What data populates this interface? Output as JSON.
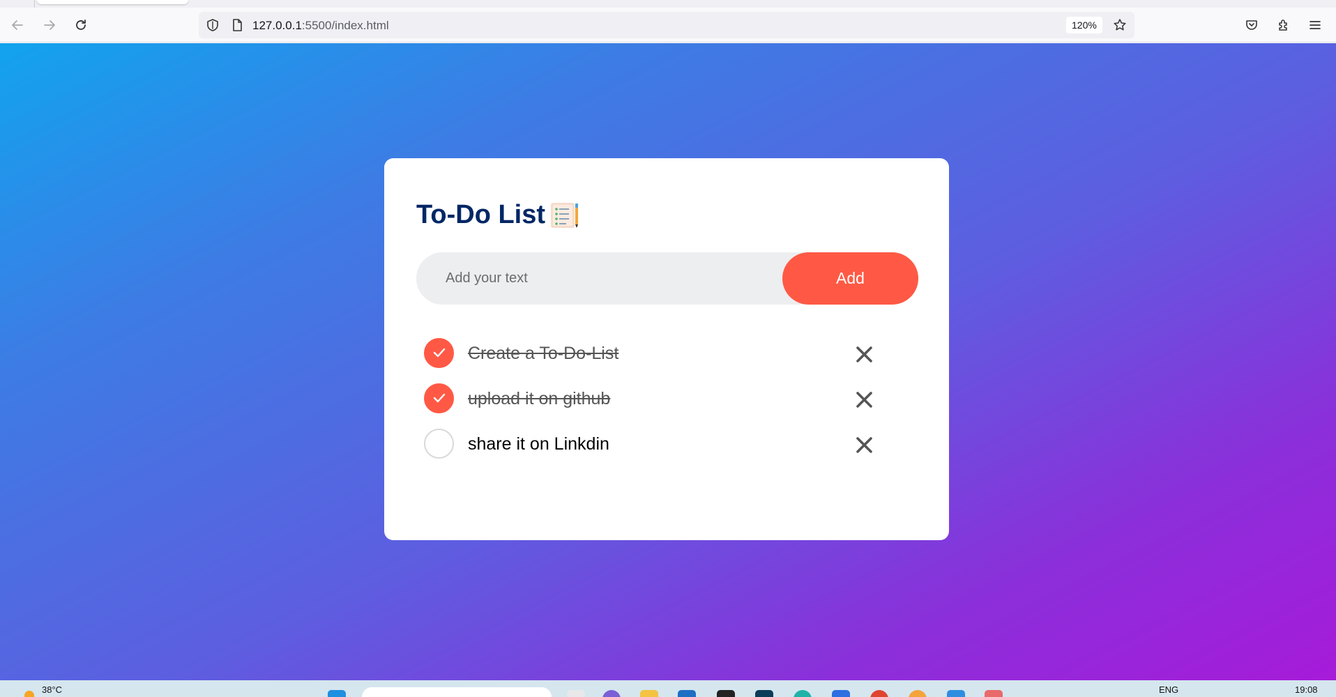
{
  "browser": {
    "url_host": "127.0.0.1",
    "url_rest": ":5500/index.html",
    "zoom": "120%"
  },
  "app": {
    "title": "To-Do List",
    "input_placeholder": "Add your text",
    "add_label": "Add",
    "tasks": [
      {
        "text": "Create a To-Do-List",
        "done": true
      },
      {
        "text": "upload it on github",
        "done": true
      },
      {
        "text": "share it on Linkdin",
        "done": false
      }
    ]
  },
  "taskbar": {
    "weather": "38°C",
    "language": "ENG",
    "time": "19:08"
  },
  "colors": {
    "accent": "#ff5945",
    "title": "#002765",
    "gradient_start": "#12a3ee",
    "gradient_end": "#a61bd9"
  }
}
